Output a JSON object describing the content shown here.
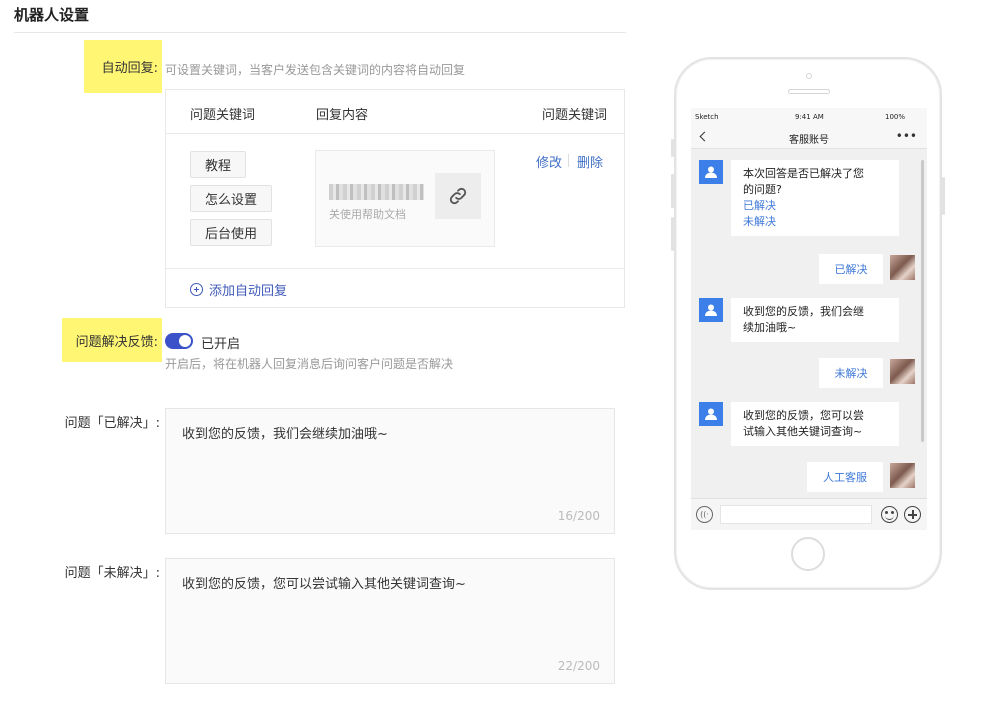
{
  "page": {
    "title": "机器人设置"
  },
  "auto_reply": {
    "label": "自动回复:",
    "hint": "可设置关键词，当客户发送包含关键词的内容将自动回复",
    "columns": [
      "问题关键词",
      "回复内容",
      "问题关键词"
    ],
    "keywords": [
      "教程",
      "怎么设置",
      "后台使用"
    ],
    "reply_card": {
      "desc": "关使用帮助文档",
      "icon": "link-icon"
    },
    "ops": {
      "edit": "修改",
      "delete": "删除"
    },
    "add_label": "添加自动回复"
  },
  "feedback": {
    "label": "问题解决反馈:",
    "toggle_state": "已开启",
    "enabled": true,
    "hint": "开启后，将在机器人回复消息后询问客户问题是否解决"
  },
  "resolved": {
    "label": "问题「已解决」:",
    "text": "收到您的反馈，我们会继续加油哦~",
    "count": "16/200"
  },
  "unresolved": {
    "label": "问题「未解决」:",
    "text": "收到您的反馈，您可以尝试输入其他关键词查询~",
    "count": "22/200"
  },
  "phone": {
    "status": {
      "carrier": "Sketch",
      "time": "9:41 AM",
      "battery": "100%"
    },
    "nav_title": "客服账号",
    "messages": {
      "q1_line1": "本次回答是否已解决了您",
      "q1_line2": "的问题?",
      "q1_opt1": "已解决",
      "q1_opt2": "未解决",
      "user1": "已解决",
      "bot2_line1": "收到您的反馈，我们会继",
      "bot2_line2": "续加油哦~",
      "user2": "未解决",
      "bot3_line1": "收到您的反馈，您可以尝",
      "bot3_line2": "试输入其他关键词查询~",
      "user3": "人工客服"
    }
  }
}
